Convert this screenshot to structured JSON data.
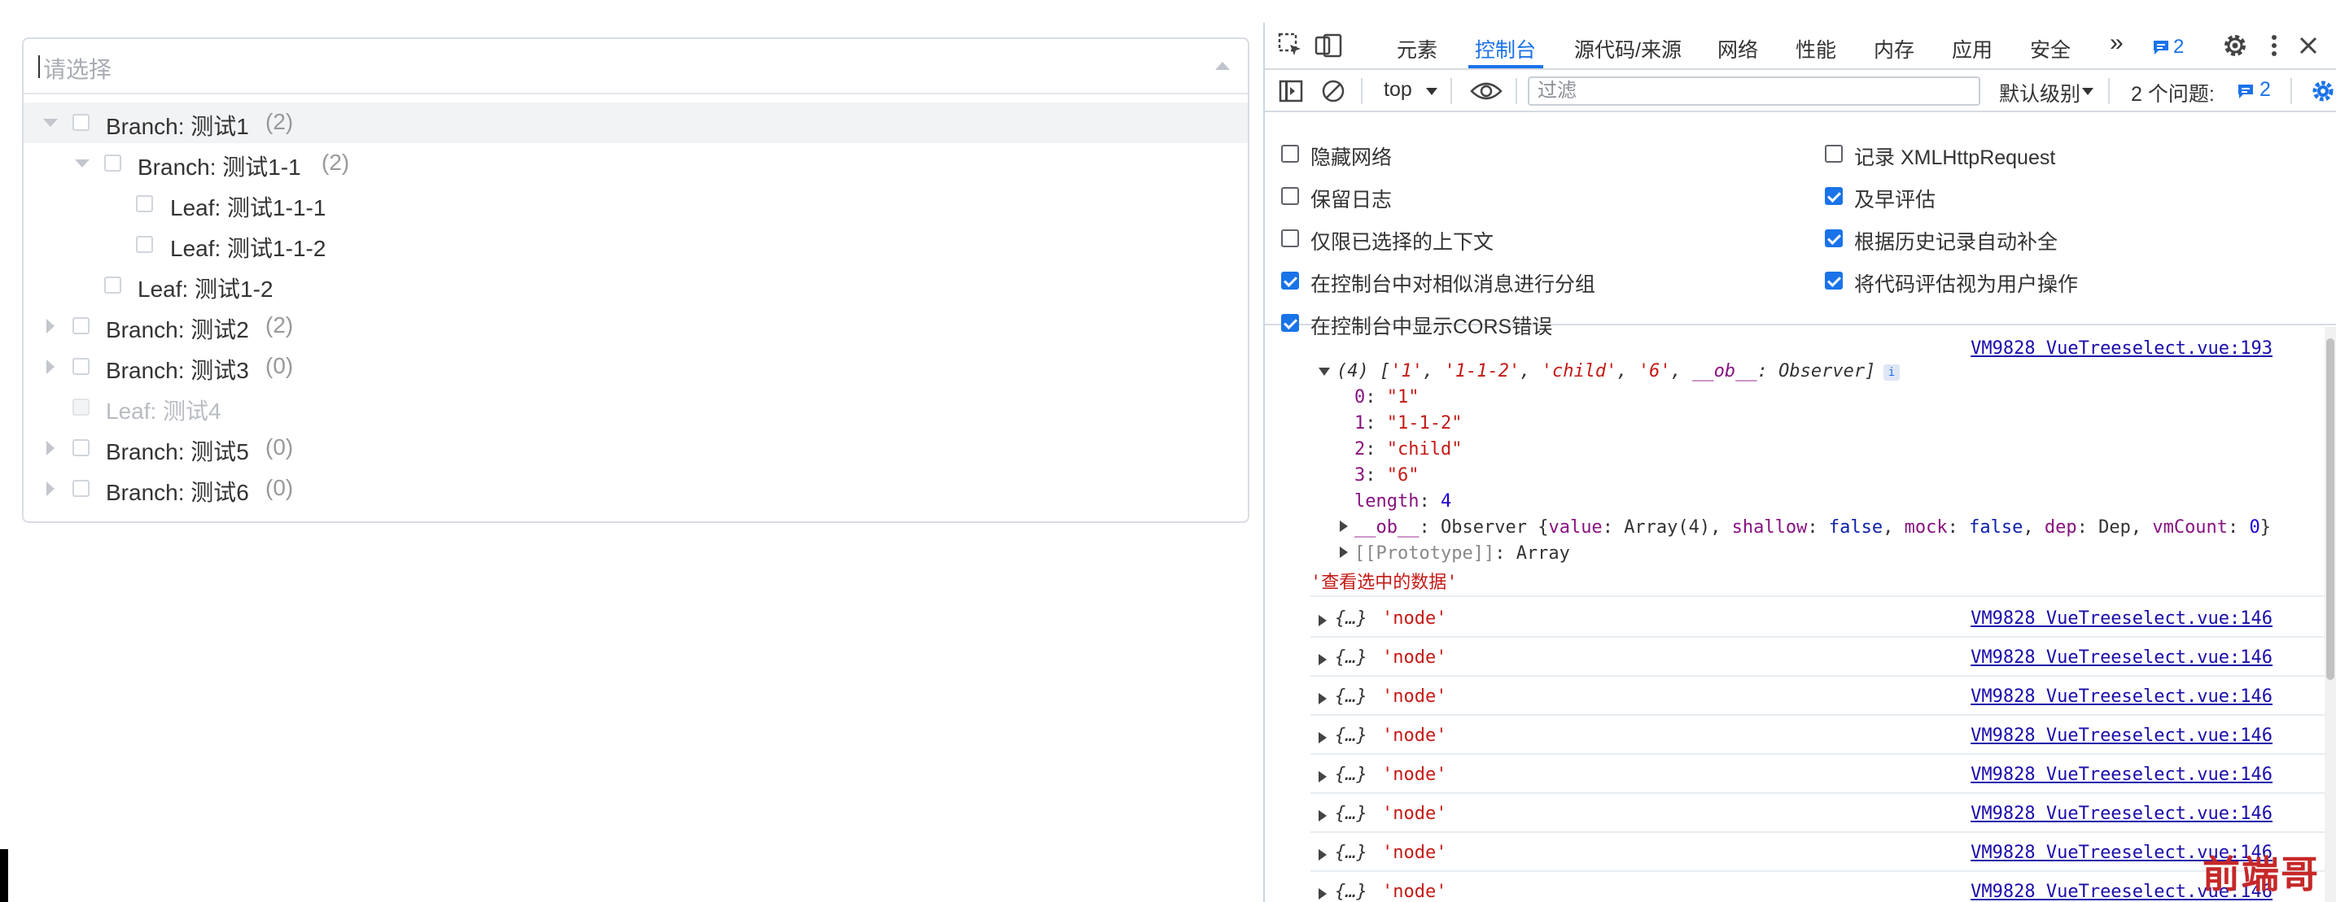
{
  "treeselect": {
    "placeholder": "请选择",
    "options": [
      {
        "label": "Branch: 测试1",
        "count": "(2)"
      },
      {
        "label": "Branch: 测试1-1",
        "count": "(2)"
      },
      {
        "label": "Leaf: 测试1-1-1"
      },
      {
        "label": "Leaf: 测试1-1-2"
      },
      {
        "label": "Leaf: 测试1-2"
      },
      {
        "label": "Branch: 测试2",
        "count": "(2)"
      },
      {
        "label": "Branch: 测试3",
        "count": "(0)"
      },
      {
        "label": "Leaf: 测试4"
      },
      {
        "label": "Branch: 测试5",
        "count": "(0)"
      },
      {
        "label": "Branch: 测试6",
        "count": "(0)"
      }
    ]
  },
  "devtools": {
    "tabs": [
      "元素",
      "控制台",
      "源代码/来源",
      "网络",
      "性能",
      "内存",
      "应用",
      "安全"
    ],
    "active_tab": "控制台",
    "more_tabs": "»",
    "issues_badge": "2",
    "toolbar": {
      "context": "top",
      "filter_placeholder": "过滤",
      "level": "默认级别",
      "issues": "2 个问题:",
      "issues_count": "2"
    },
    "settings_left": [
      {
        "label": "隐藏网络",
        "checked": false
      },
      {
        "label": "保留日志",
        "checked": false
      },
      {
        "label": "仅限已选择的上下文",
        "checked": false
      },
      {
        "label": "在控制台中对相似消息进行分组",
        "checked": true
      },
      {
        "label": "在控制台中显示CORS错误",
        "checked": true
      }
    ],
    "settings_right": [
      {
        "label": "记录 XMLHttpRequest",
        "checked": false
      },
      {
        "label": "及早评估",
        "checked": true
      },
      {
        "label": "根据历史记录自动补全",
        "checked": true
      },
      {
        "label": "将代码评估视为用户操作",
        "checked": true
      }
    ],
    "console": {
      "array_source": "VM9828 VueTreeselect.vue:193",
      "array_summary_prefix": "(4) [",
      "array_summary_items": [
        "'1'",
        "'1-1-2'",
        "'child'",
        "'6'"
      ],
      "array_summary_ob_key": "__ob__",
      "array_summary_ob_val": "Observer",
      "array_summary_suffix": "]",
      "entries": [
        {
          "key": "0",
          "value": "\"1\""
        },
        {
          "key": "1",
          "value": "\"1-1-2\""
        },
        {
          "key": "2",
          "value": "\"child\""
        },
        {
          "key": "3",
          "value": "\"6\""
        }
      ],
      "length_key": "length",
      "length_value": "4",
      "ob_key": "__ob__",
      "ob_class": "Observer",
      "ob_value_key": "value",
      "ob_value_val": "Array(4)",
      "ob_shallow_key": "shallow",
      "ob_shallow_val": "false",
      "ob_mock_key": "mock",
      "ob_mock_val": "false",
      "ob_dep_key": "dep",
      "ob_dep_val": "Dep",
      "ob_vmcount_key": "vmCount",
      "ob_vmcount_val": "0",
      "proto_key": "[[Prototype]]",
      "proto_val": "Array",
      "string_msg": "'查看选中的数据'",
      "node_logs": [
        {
          "obj": "{…}",
          "text": "'node'",
          "source": "VM9828 VueTreeselect.vue:146"
        },
        {
          "obj": "{…}",
          "text": "'node'",
          "source": "VM9828 VueTreeselect.vue:146"
        },
        {
          "obj": "{…}",
          "text": "'node'",
          "source": "VM9828 VueTreeselect.vue:146"
        },
        {
          "obj": "{…}",
          "text": "'node'",
          "source": "VM9828 VueTreeselect.vue:146"
        },
        {
          "obj": "{…}",
          "text": "'node'",
          "source": "VM9828 VueTreeselect.vue:146"
        },
        {
          "obj": "{…}",
          "text": "'node'",
          "source": "VM9828 VueTreeselect.vue:146"
        },
        {
          "obj": "{…}",
          "text": "'node'",
          "source": "VM9828 VueTreeselect.vue:146"
        },
        {
          "obj": "{…}",
          "text": "'node'",
          "source": "VM9828 VueTreeselect.vue:146"
        }
      ]
    }
  },
  "watermark": "前端哥",
  "colors": {
    "accent": "#1a73e8",
    "string": "#c41a16",
    "key": "#881280",
    "number": "#1c00cf"
  }
}
